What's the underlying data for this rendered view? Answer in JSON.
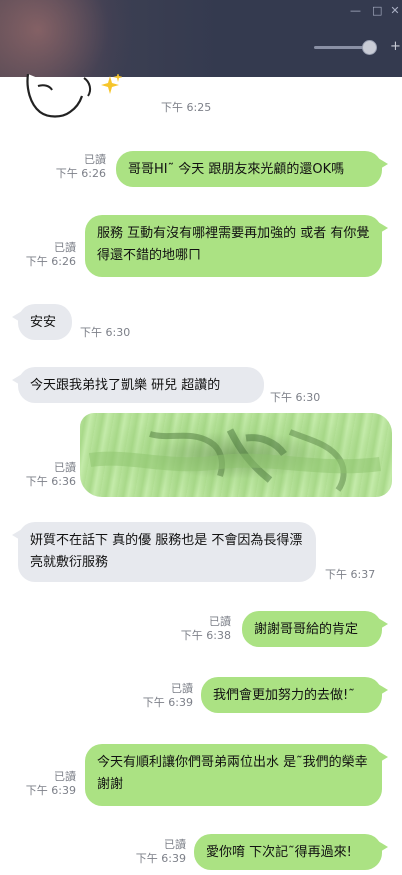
{
  "header": {
    "minimize": "—",
    "maximize": "□",
    "close": "✕",
    "zoom_plus": "+"
  },
  "messages": [
    {
      "id": "m0",
      "side": "in",
      "type": "sticker",
      "time": "下午 6:25"
    },
    {
      "id": "m1",
      "side": "out",
      "text": "哥哥HI˜ 今天 跟朋友來光顧的還OK嗎",
      "read": "已讀",
      "time": "下午 6:26"
    },
    {
      "id": "m2",
      "side": "out",
      "text": "服務 互動有沒有哪裡需要再加強的 或者 有你覺得還不錯的地哪ㄇ",
      "read": "已讀",
      "time": "下午 6:26"
    },
    {
      "id": "m3",
      "side": "in",
      "text": "安安",
      "time": "下午 6:30"
    },
    {
      "id": "m4",
      "side": "in",
      "text": "今天跟我弟找了凱樂 研兒 超讚的",
      "time": "下午 6:30"
    },
    {
      "id": "m5",
      "side": "out",
      "type": "image",
      "read": "已讀",
      "time": "下午 6:36"
    },
    {
      "id": "m6",
      "side": "in",
      "text": "妍質不在話下 真的優 服務也是 不會因為長得漂亮就敷衍服務",
      "time": "下午 6:37"
    },
    {
      "id": "m7",
      "side": "out",
      "text": "謝謝哥哥給的肯定",
      "read": "已讀",
      "time": "下午 6:38"
    },
    {
      "id": "m8",
      "side": "out",
      "text": "我們會更加努力的去做!˜",
      "read": "已讀",
      "time": "下午 6:39"
    },
    {
      "id": "m9",
      "side": "out",
      "text": "今天有順利讓你們哥弟兩位出水 是˜我們的榮幸 謝謝",
      "read": "已讀",
      "time": "下午 6:39"
    },
    {
      "id": "m10",
      "side": "out",
      "text": "愛你唷 下次記˜得再過來!",
      "read": "已讀",
      "time": "下午 6:39"
    }
  ],
  "colors": {
    "outgoing_bubble": "#abe283",
    "incoming_bubble": "#e7e9ee",
    "header_bg": "#343a4f",
    "meta_text": "#7d8089"
  }
}
